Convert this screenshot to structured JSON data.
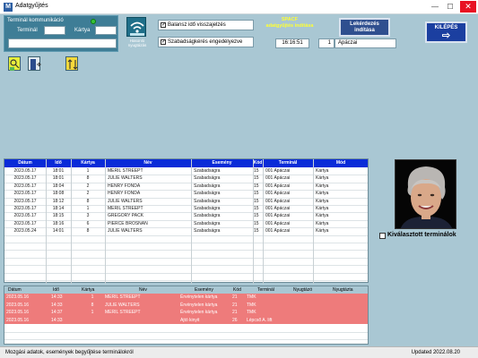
{
  "window": {
    "title": "Adatgyűjtés",
    "minimize": "—",
    "maximize": "☐",
    "close": "✕"
  },
  "comm_panel": {
    "title": "Terminál kommunikáció",
    "terminal_label": "Terminál",
    "card_label": "Kártya",
    "terminal_value": "",
    "card_value": "",
    "message_value": ""
  },
  "wifi": {
    "label_line1": "Hasonló",
    "label_line2": "nyugtázás"
  },
  "checks": [
    {
      "label": "Balansz idő visszajelzés",
      "checked": true
    },
    {
      "label": "Szabadságkérés engedélyezve",
      "checked": true
    }
  ],
  "spacf": {
    "line1": "SPACF",
    "line2": "adatgyűjtés indítása"
  },
  "time": "16:16:51",
  "terminal_num": "1",
  "place": "Apáczai",
  "btn_query": {
    "line1": "Lekérdezés",
    "line2": "indítása"
  },
  "btn_exit": {
    "label": "KILÉPÉS",
    "arrow": "⇨"
  },
  "colors": {
    "bg": "#a9c7d3",
    "header_blue": "#0a2bd8",
    "panel": "#3e7d96",
    "alert_row": "#ee7b7b"
  },
  "main_table": {
    "columns": [
      "Dátum",
      "Idő",
      "Kártya",
      "Név",
      "Esemény",
      "Kód",
      "Terminál",
      "Mód"
    ],
    "rows": [
      [
        "2023.05.17",
        "18:01",
        "1",
        "MERIL STREEPT",
        "Szabadságra",
        "15",
        "001 Apáczai",
        "Kártya"
      ],
      [
        "2023.05.17",
        "18:01",
        "8",
        "JULIE WALTERS",
        "Szabadságra",
        "15",
        "001 Apáczai",
        "Kártya"
      ],
      [
        "2023.05.17",
        "18:04",
        "2",
        "HENRY FONDA",
        "Szabadságra",
        "15",
        "001 Apáczai",
        "Kártya"
      ],
      [
        "2023.05.17",
        "18:08",
        "2",
        "HENRY FONDA",
        "Szabadságra",
        "15",
        "001 Apáczai",
        "Kártya"
      ],
      [
        "2023.05.17",
        "18:12",
        "8",
        "JULIE WALTERS",
        "Szabadságra",
        "15",
        "001 Apáczai",
        "Kártya"
      ],
      [
        "2023.05.17",
        "18:14",
        "1",
        "MERIL STREEPT",
        "Szabadságra",
        "15",
        "001 Apáczai",
        "Kártya"
      ],
      [
        "2023.05.17",
        "18:15",
        "3",
        "GREGORY PACK",
        "Szabadságra",
        "15",
        "001 Apáczai",
        "Kártya"
      ],
      [
        "2023.05.17",
        "18:16",
        "6",
        "PIERCE BROSNAN",
        "Szabadságra",
        "15",
        "001 Apáczai",
        "Kártya"
      ],
      [
        "2023.05.24",
        "14:01",
        "8",
        "JULIE WALTERS",
        "Szabadságra",
        "15",
        "001 Apáczai",
        "Kártya"
      ]
    ]
  },
  "alert_table": {
    "columns": [
      "Dátum",
      "Idő",
      "Kártya",
      "Név",
      "Esemény",
      "Kód",
      "Terminál",
      "Nyugtázó",
      "Nyugtázta"
    ],
    "rows": [
      [
        "2023.05.16",
        "14:33",
        "1",
        "MERIL STREEPT",
        "Érvénytelen kártya",
        "21",
        "TMK",
        "",
        ""
      ],
      [
        "2023.05.16",
        "14:33",
        "8",
        "JULIE WALTERS",
        "Érvénytelen kártya",
        "21",
        "TMK",
        "",
        ""
      ],
      [
        "2023.05.16",
        "14:37",
        "1",
        "MERIL STREEPT",
        "Érvénytelen kártya",
        "21",
        "TMK",
        "",
        ""
      ],
      [
        "2023.05.16",
        "14:33",
        "",
        "",
        "Ajtó kinyit",
        "26",
        "Lépcső A. lift",
        "",
        ""
      ]
    ]
  },
  "selected_terminals": {
    "label": "Kiválasztott terminálok",
    "checked": false
  },
  "status": {
    "left": "Mozgási adatok, események begyűjtése terminálokról",
    "right": "Updated 2022.08.20"
  }
}
